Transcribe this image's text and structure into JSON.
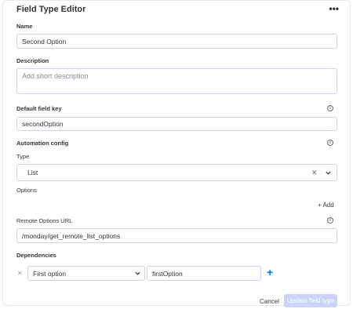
{
  "header": {
    "title": "Field Type Editor",
    "more_icon": "more-horizontal-icon"
  },
  "name": {
    "label": "Name",
    "value": "Second Option"
  },
  "description": {
    "label": "Description",
    "placeholder": "Add short description"
  },
  "default_field_key": {
    "label": "Default field key",
    "value": "secondOption",
    "info_icon": "info-icon"
  },
  "automation_config": {
    "label": "Automation config",
    "info_icon": "info-icon",
    "type_label": "Type",
    "type_value": "List"
  },
  "options": {
    "label": "Options",
    "add_label": "+ Add"
  },
  "remote_options": {
    "label": "Remote Options URL",
    "value": "/monday/get_remote_list_options",
    "info_icon": "info-icon"
  },
  "dependencies": {
    "label": "Dependencies",
    "rows": [
      {
        "select_value": "First option",
        "key_value": "firstOption"
      }
    ],
    "add_icon": "plus-icon"
  },
  "footer": {
    "cancel_label": "Cancel",
    "update_label": "Update field type"
  },
  "colors": {
    "accent": "#0073ea",
    "disabled_button": "#c9d4f6",
    "border": "#d0d4e4"
  }
}
